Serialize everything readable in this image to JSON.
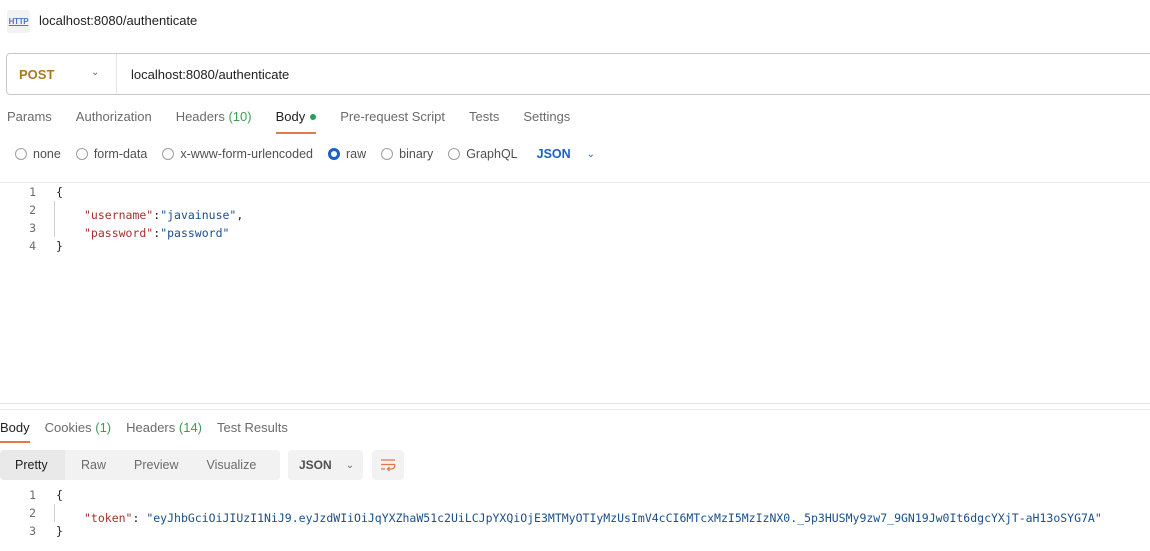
{
  "title_bar": {
    "icon": "http-icon",
    "icon_text": "HTTP",
    "title": "localhost:8080/authenticate"
  },
  "request": {
    "method": "POST",
    "url": "localhost:8080/authenticate",
    "tabs": [
      {
        "label": "Params",
        "count": ""
      },
      {
        "label": "Authorization",
        "count": ""
      },
      {
        "label": "Headers",
        "count": "(10)"
      },
      {
        "label": "Body",
        "count": "",
        "active": true,
        "indicator": "green-dot"
      },
      {
        "label": "Pre-request Script",
        "count": ""
      },
      {
        "label": "Tests",
        "count": ""
      },
      {
        "label": "Settings",
        "count": ""
      }
    ],
    "body_types": [
      {
        "label": "none",
        "checked": false
      },
      {
        "label": "form-data",
        "checked": false
      },
      {
        "label": "x-www-form-urlencoded",
        "checked": false
      },
      {
        "label": "raw",
        "checked": true
      },
      {
        "label": "binary",
        "checked": false
      },
      {
        "label": "GraphQL",
        "checked": false
      }
    ],
    "raw_format": "JSON",
    "body_lines": [
      {
        "n": "1",
        "open": "{"
      },
      {
        "n": "2",
        "key": "\"username\"",
        "sep": ":",
        "value": "\"javainuse\"",
        "trail": ","
      },
      {
        "n": "3",
        "key": "\"password\"",
        "sep": ":",
        "value": "\"password\"",
        "trail": ""
      },
      {
        "n": "4",
        "close": "}"
      }
    ]
  },
  "response": {
    "tabs": [
      {
        "label": "Body",
        "count": "",
        "active": true
      },
      {
        "label": "Cookies",
        "count": "(1)"
      },
      {
        "label": "Headers",
        "count": "(14)"
      },
      {
        "label": "Test Results",
        "count": ""
      }
    ],
    "views": [
      "Pretty",
      "Raw",
      "Preview",
      "Visualize"
    ],
    "active_view": "Pretty",
    "format": "JSON",
    "wrap_icon": "wrap-lines-icon",
    "body_lines": [
      {
        "n": "1",
        "open": "{"
      },
      {
        "n": "2",
        "key": "\"token\"",
        "sep": ": ",
        "value": "\"eyJhbGciOiJIUzI1NiJ9.eyJzdWIiOiJqYXZhaW51c2UiLCJpYXQiOjE3MTMyOTIyMzUsImV4cCI6MTcxMzI5MzIzNX0._5p3HUSMy9zw7_9GN19Jw0It6dgcYXjT-aH13oSYG7A\""
      },
      {
        "n": "3",
        "close": "}"
      }
    ]
  },
  "colors": {
    "method": "#a77a1d",
    "accent_blue": "#1b60c4",
    "active_tab_underline": "#e07a4a",
    "count_green": "#3c9c55",
    "json_key": "#a3312b",
    "json_string": "#1a4f8a"
  }
}
